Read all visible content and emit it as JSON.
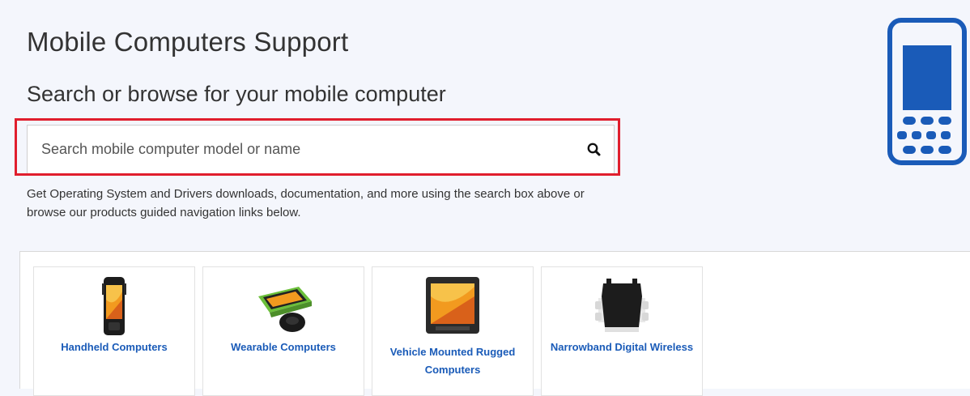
{
  "header": {
    "title": "Mobile Computers Support",
    "subtitle": "Search or browse for your mobile computer"
  },
  "search": {
    "placeholder": "Search mobile computer model or name",
    "button_icon": "search-icon",
    "highlight_color": "#e01e2d"
  },
  "description": "Get Operating System and Drivers downloads, documentation, and more using the search box above or browse our products guided navigation links below.",
  "hero_icon": {
    "name": "mobile-computer-icon",
    "color": "#1a5bb8"
  },
  "products": [
    {
      "label": "Handheld Computers",
      "image": "handheld-computer-image"
    },
    {
      "label": "Wearable Computers",
      "image": "wearable-computer-image"
    },
    {
      "label": "Vehicle Mounted Rugged Computers",
      "image": "vehicle-mounted-computer-image"
    },
    {
      "label": "Narrowband Digital Wireless",
      "image": "narrowband-wireless-image"
    }
  ],
  "colors": {
    "background": "#f4f6fc",
    "link": "#1a5bb8",
    "text": "#333333"
  }
}
